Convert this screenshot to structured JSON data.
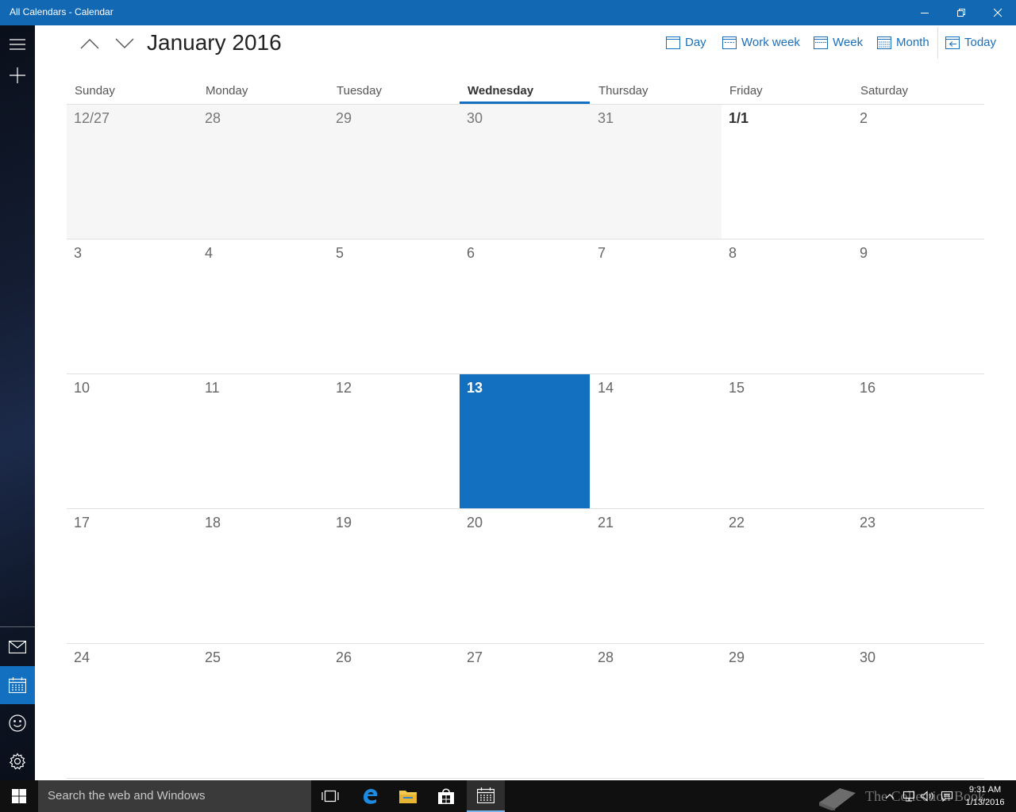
{
  "window": {
    "title": "All Calendars - Calendar"
  },
  "header": {
    "month_title": "January 2016"
  },
  "views": [
    {
      "id": "day",
      "label": "Day"
    },
    {
      "id": "workweek",
      "label": "Work week"
    },
    {
      "id": "week",
      "label": "Week"
    },
    {
      "id": "month",
      "label": "Month"
    },
    {
      "id": "today",
      "label": "Today"
    }
  ],
  "weekdays": [
    "Sunday",
    "Monday",
    "Tuesday",
    "Wednesday",
    "Thursday",
    "Friday",
    "Saturday"
  ],
  "today_weekday": "Wednesday",
  "weeks": [
    [
      "12/27",
      "28",
      "29",
      "30",
      "31",
      "1/1",
      "2"
    ],
    [
      "3",
      "4",
      "5",
      "6",
      "7",
      "8",
      "9"
    ],
    [
      "10",
      "11",
      "12",
      "13",
      "14",
      "15",
      "16"
    ],
    [
      "17",
      "18",
      "19",
      "20",
      "21",
      "22",
      "23"
    ],
    [
      "24",
      "25",
      "26",
      "27",
      "28",
      "29",
      "30"
    ]
  ],
  "today_date": "13",
  "taskbar": {
    "search_placeholder": "Search the web and Windows",
    "time": "9:31 AM",
    "date": "1/13/2016",
    "watermark": "The Collection Book"
  },
  "colors": {
    "accent": "#1370c0",
    "titlebar": "#1268b3"
  }
}
